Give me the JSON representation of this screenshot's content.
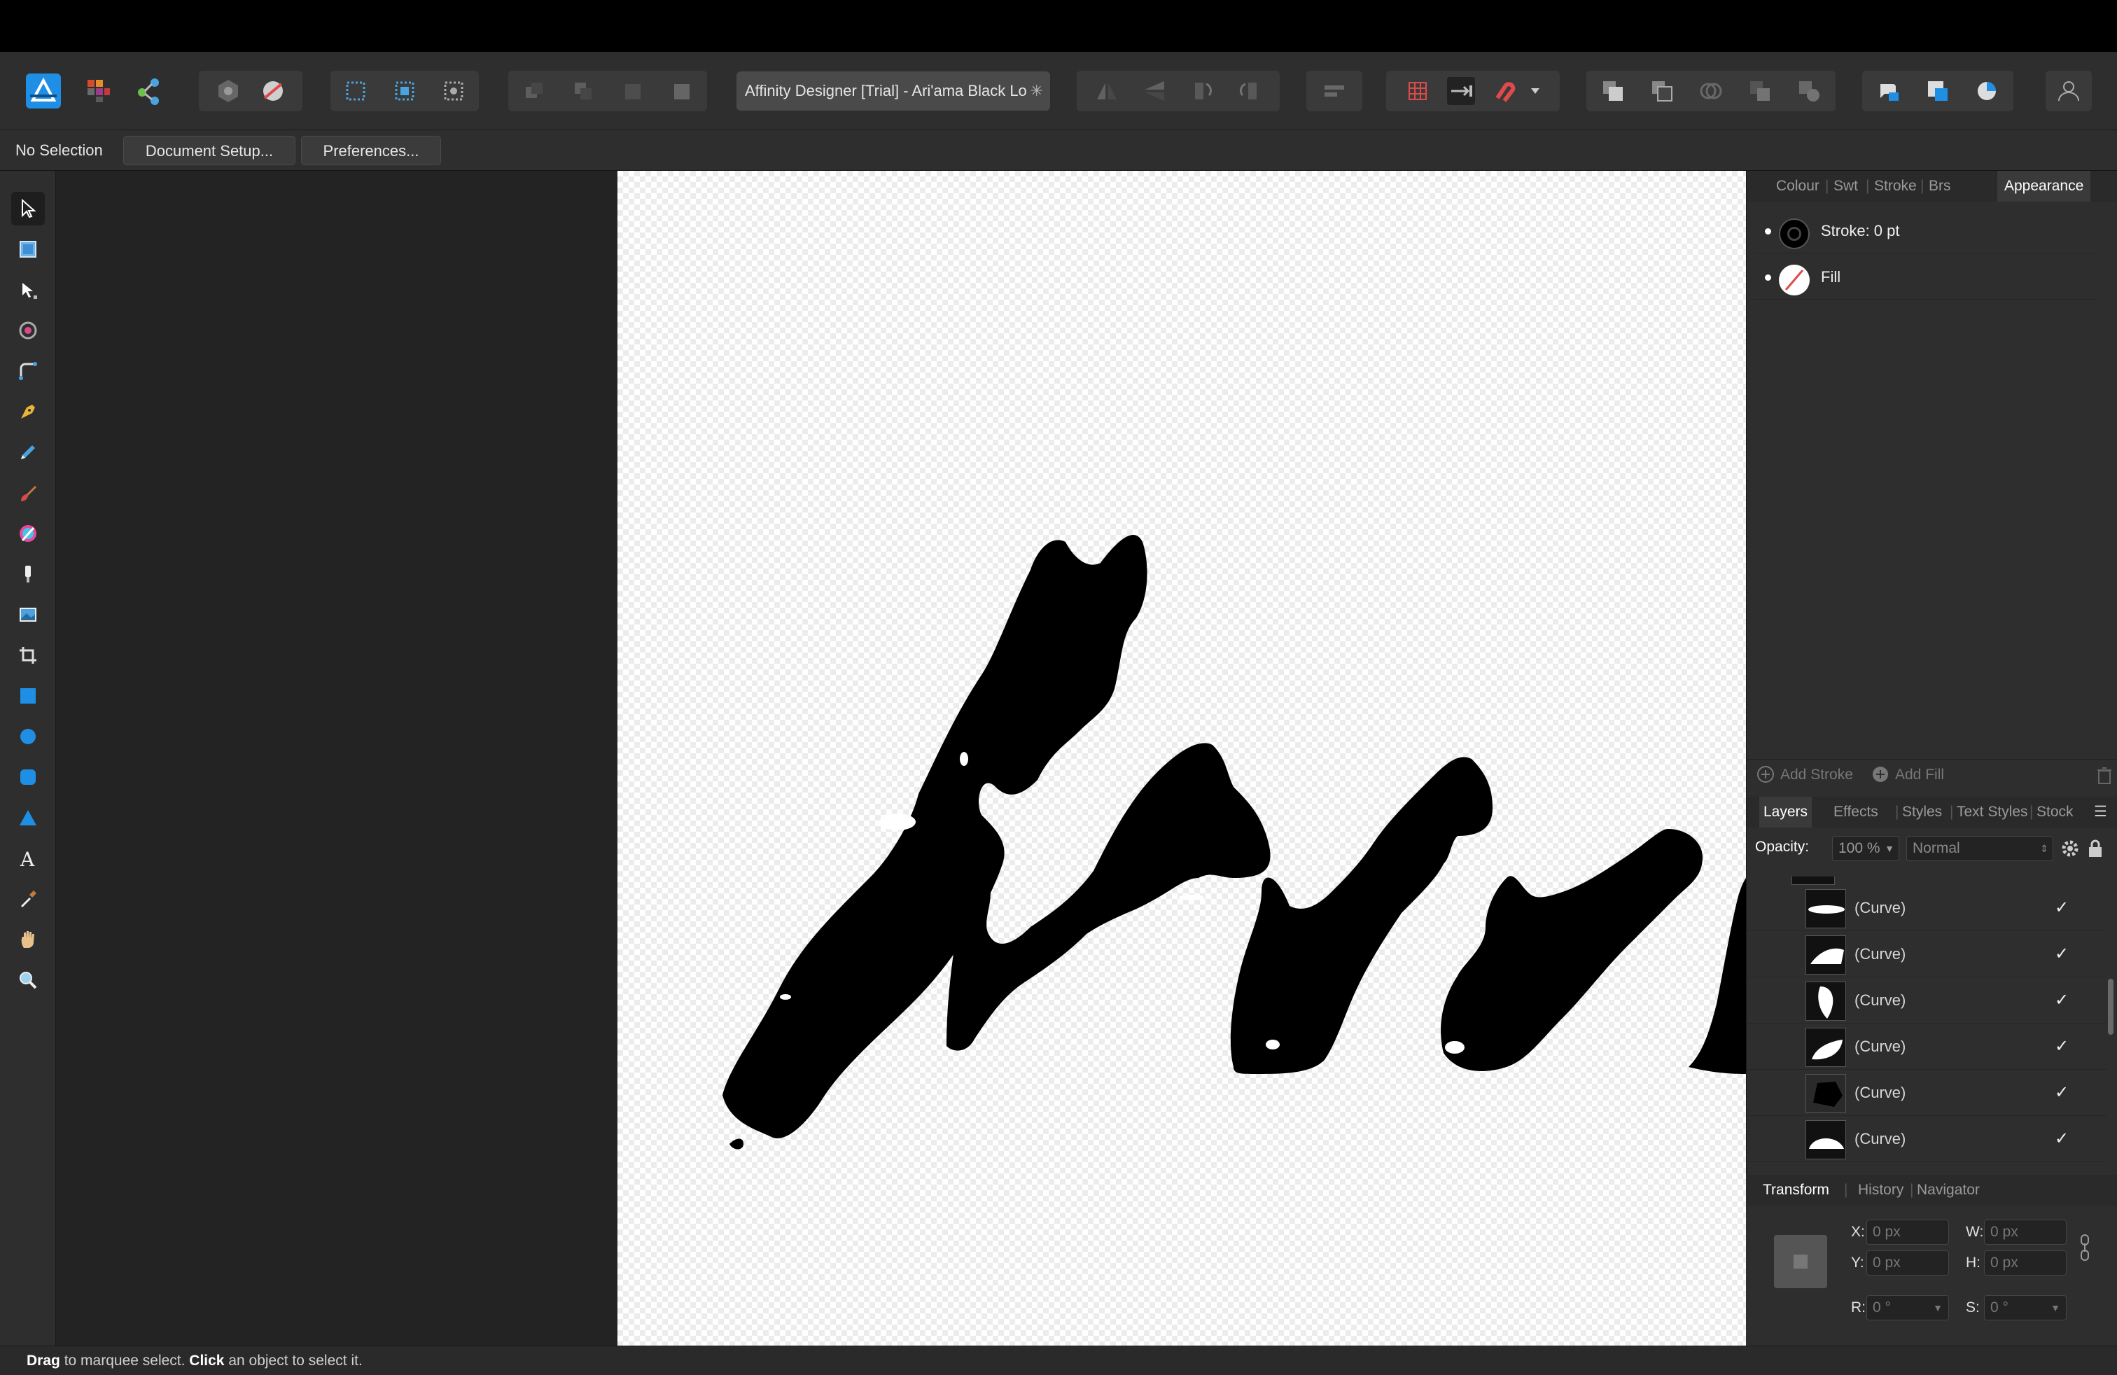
{
  "app": {
    "document_title": "Affinity Designer [Trial] - Ari'ama Black Lo",
    "modified_mark": "✳"
  },
  "context_toolbar": {
    "selection": "No Selection",
    "document_setup": "Document Setup...",
    "preferences": "Preferences..."
  },
  "top_tabs": {
    "colour": "Colour",
    "swatches": "Swt",
    "stroke": "Stroke",
    "brushes": "Brs",
    "appearance": "Appearance"
  },
  "appearance": {
    "stroke_label": "Stroke: 0 pt",
    "fill_label": "Fill",
    "add_stroke": "Add Stroke",
    "add_fill": "Add Fill"
  },
  "layers_tabs": {
    "layers": "Layers",
    "effects": "Effects",
    "styles": "Styles",
    "text_styles": "Text Styles",
    "stock": "Stock"
  },
  "layers": {
    "opacity_label": "Opacity:",
    "opacity_value": "100 %",
    "blend_mode": "Normal",
    "items": [
      {
        "name": "(Curve)",
        "checked": "✓"
      },
      {
        "name": "(Curve)",
        "checked": "✓"
      },
      {
        "name": "(Curve)",
        "checked": "✓"
      },
      {
        "name": "(Curve)",
        "checked": "✓"
      },
      {
        "name": "(Curve)",
        "checked": "✓"
      },
      {
        "name": "(Curve)",
        "checked": "✓"
      }
    ]
  },
  "bottom_tabs": {
    "transform": "Transform",
    "history": "History",
    "navigator": "Navigator"
  },
  "transform": {
    "x_label": "X:",
    "x_value": "0 px",
    "y_label": "Y:",
    "y_value": "0 px",
    "w_label": "W:",
    "w_value": "0 px",
    "h_label": "H:",
    "h_value": "0 px",
    "r_label": "R:",
    "r_value": "0 °",
    "s_label": "S:",
    "s_value": "0 °"
  },
  "status": {
    "drag": "Drag",
    "drag_text": " to marquee select. ",
    "click": "Click",
    "click_text": " an object to select it."
  },
  "colors": {
    "accent": "#1f8fe5",
    "panel_bg": "#2e2e2e",
    "canvas_ink": "#000000"
  }
}
